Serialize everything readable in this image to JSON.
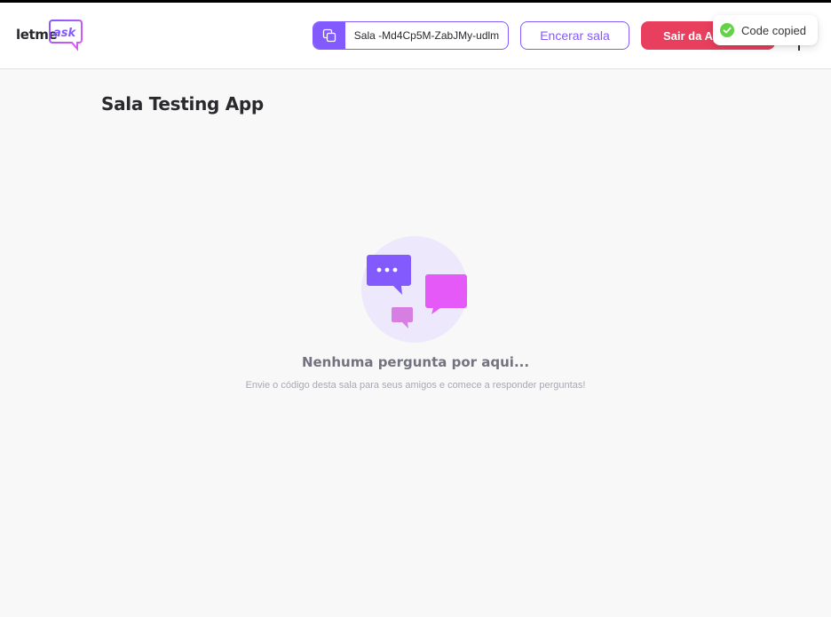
{
  "header": {
    "logo_text": "letme",
    "logo_accent": "ask",
    "room_code_label": "Sala -Md4Cp5M-ZabJMy-udlm",
    "end_room_label": "Encerar sala",
    "leave_label": "Sair da Ap"
  },
  "toast": {
    "message": "Code copied"
  },
  "page": {
    "title": "Sala Testing App"
  },
  "empty_state": {
    "title": "Nenhuma pergunta por aqui...",
    "description": "Envie o código desta sala para seus amigos e comece a responder perguntas!"
  },
  "colors": {
    "brand_purple": "#835afd",
    "brand_pink": "#e559f9",
    "danger": "#e73f5d",
    "success": "#61d345",
    "background": "#f8f8f8"
  },
  "icons": {
    "copy": "copy-icon",
    "success": "check-circle-icon",
    "illustration": "chat-bubbles-illustration"
  }
}
